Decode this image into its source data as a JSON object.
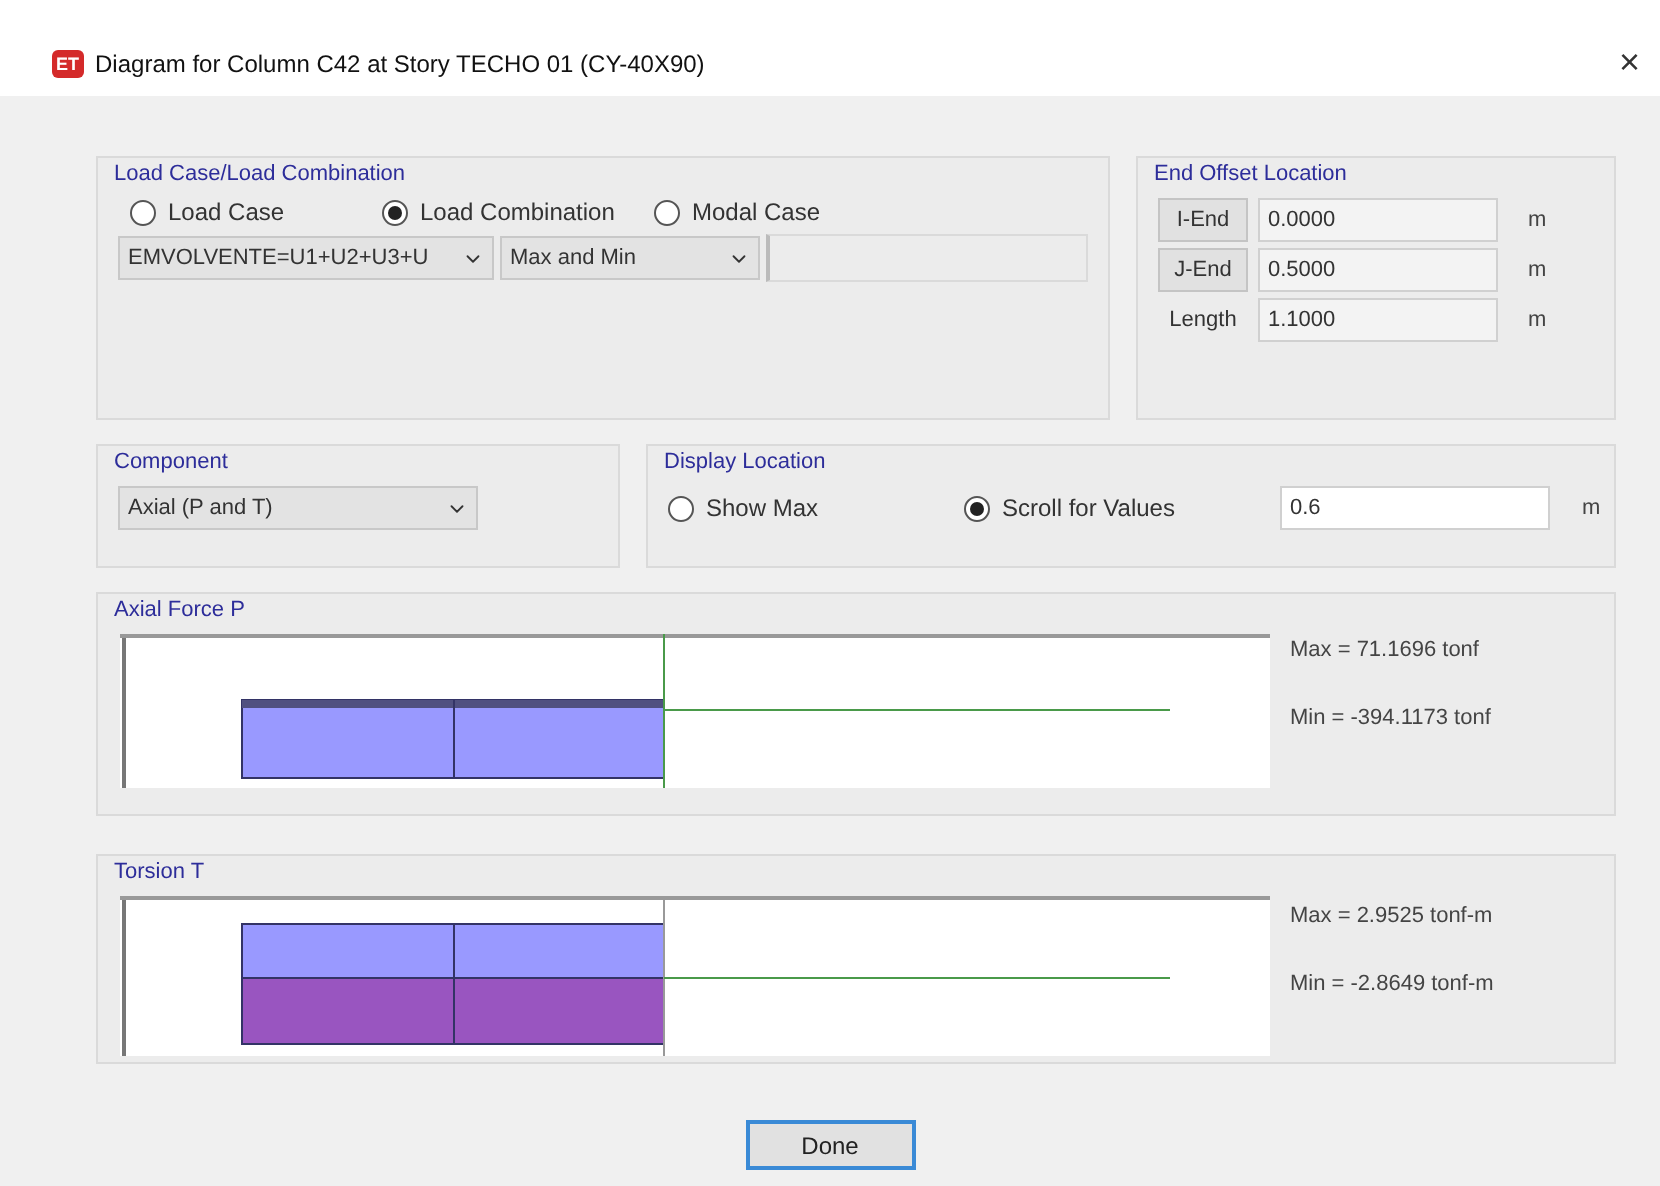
{
  "window": {
    "title": "Diagram for Column C42 at Story TECHO 01 (CY-40X90)",
    "app_badge": "ET",
    "close": "×"
  },
  "load_case": {
    "legend": "Load Case/Load Combination",
    "options": [
      {
        "label": "Load Case",
        "selected": false
      },
      {
        "label": "Load Combination",
        "selected": true
      },
      {
        "label": "Modal Case",
        "selected": false
      }
    ],
    "combination": "EMVOLVENTE=U1+U2+U3+U",
    "type": "Max and Min"
  },
  "end_offset": {
    "legend": "End Offset Location",
    "rows": [
      {
        "kind": "button",
        "label": "I-End",
        "value": "0.0000",
        "unit": "m"
      },
      {
        "kind": "button",
        "label": "J-End",
        "value": "0.5000",
        "unit": "m"
      },
      {
        "kind": "label",
        "label": "Length",
        "value": "1.1000",
        "unit": "m"
      }
    ]
  },
  "component": {
    "legend": "Component",
    "value": "Axial (P and T)"
  },
  "display_location": {
    "legend": "Display Location",
    "options": [
      {
        "label": "Show Max",
        "selected": false
      },
      {
        "label": "Scroll for Values",
        "selected": true
      }
    ],
    "value": "0.6",
    "unit": "m"
  },
  "diagrams": [
    {
      "kind": "axial",
      "title": "Axial Force P",
      "max": "Max = 71.1696 tonf",
      "min": "Min = -394.1173 tonf"
    },
    {
      "kind": "torsion",
      "title": "Torsion T",
      "max": "Max = 2.9525 tonf-m",
      "min": "Min = -2.8649 tonf-m"
    }
  ],
  "done": "Done"
}
